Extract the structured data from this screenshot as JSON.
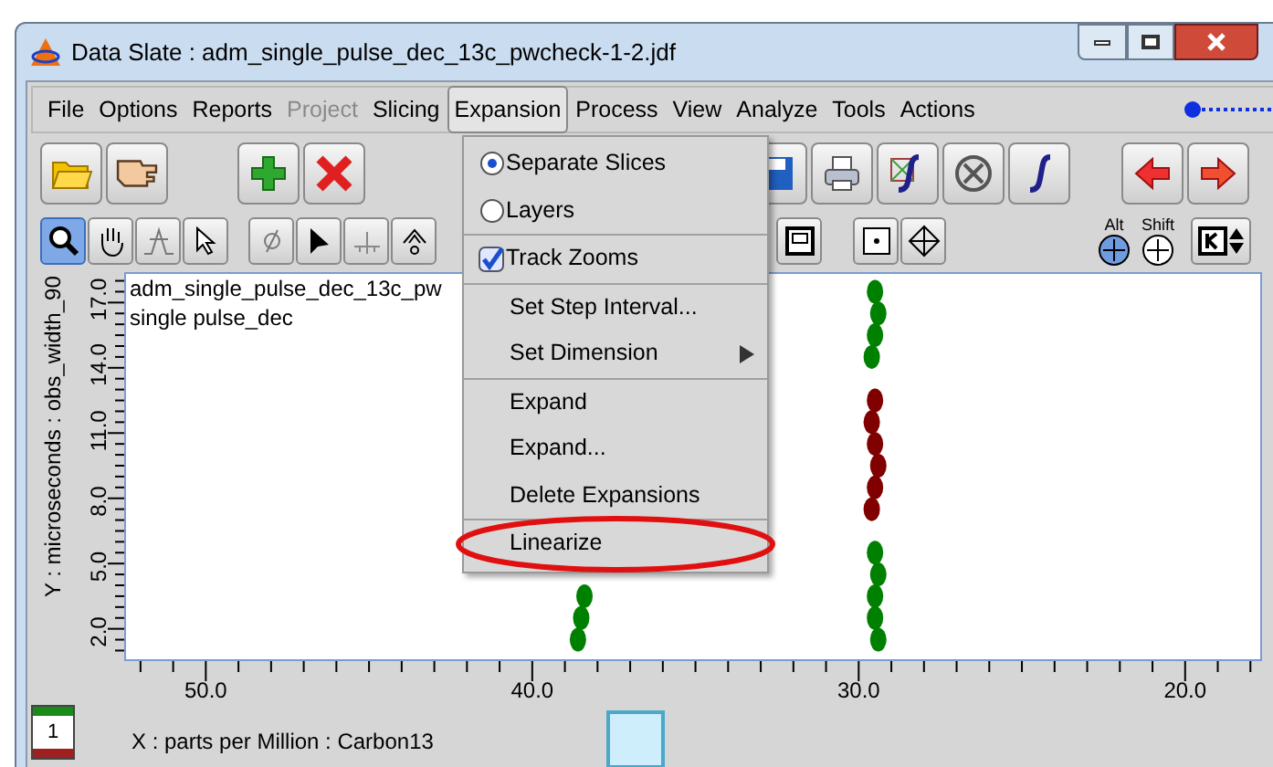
{
  "window": {
    "title": "Data Slate : adm_single_pulse_dec_13c_pwcheck-1-2.jdf"
  },
  "menu_bar": [
    {
      "label": "File",
      "disabled": false,
      "selected": false
    },
    {
      "label": "Options",
      "disabled": false,
      "selected": false
    },
    {
      "label": "Reports",
      "disabled": false,
      "selected": false
    },
    {
      "label": "Project",
      "disabled": true,
      "selected": false
    },
    {
      "label": "Slicing",
      "disabled": false,
      "selected": false
    },
    {
      "label": "Expansion",
      "disabled": false,
      "selected": true
    },
    {
      "label": "Process",
      "disabled": false,
      "selected": false
    },
    {
      "label": "View",
      "disabled": false,
      "selected": false
    },
    {
      "label": "Analyze",
      "disabled": false,
      "selected": false
    },
    {
      "label": "Tools",
      "disabled": false,
      "selected": false
    },
    {
      "label": "Actions",
      "disabled": false,
      "selected": false
    }
  ],
  "toolbar_1": [
    [
      {
        "kind": "folder"
      },
      {
        "kind": "hand"
      }
    ],
    [
      {
        "kind": "plus"
      },
      {
        "kind": "cross"
      }
    ],
    [
      {
        "kind": "save"
      },
      {
        "kind": "printer"
      },
      {
        "kind": "spline"
      },
      {
        "kind": "circle-x"
      },
      {
        "kind": "integral"
      }
    ],
    [
      {
        "kind": "arrow-left"
      },
      {
        "kind": "arrow-right"
      }
    ]
  ],
  "toolbar_2": [
    [
      {
        "kind": "zoom",
        "selected": true
      },
      {
        "kind": "pan",
        "selected": false
      },
      {
        "kind": "peak",
        "selected": false
      },
      {
        "kind": "pointer",
        "selected": false
      }
    ],
    [
      {
        "kind": "phi",
        "selected": false
      },
      {
        "kind": "arrow",
        "selected": false
      },
      {
        "kind": "baseline",
        "selected": false
      },
      {
        "kind": "hat",
        "selected": false
      }
    ],
    [
      {
        "kind": "frame",
        "selected": false
      }
    ],
    [
      {
        "kind": "dot",
        "selected": false
      },
      {
        "kind": "crosshair",
        "selected": false
      }
    ]
  ],
  "modifiers": [
    {
      "label": "Alt",
      "on": true
    },
    {
      "label": "Shift",
      "on": false
    }
  ],
  "expansion_menu": {
    "groups": [
      [
        {
          "kind": "radio",
          "label": "Separate Slices",
          "selected": true,
          "circled": false
        },
        {
          "kind": "radio",
          "label": "Layers",
          "selected": false,
          "circled": false
        }
      ],
      [
        {
          "kind": "check",
          "label": "Track Zooms",
          "checked": true,
          "circled": false
        }
      ],
      [
        {
          "kind": "command",
          "label": "Set Step Interval...",
          "circled": false
        },
        {
          "kind": "submenu",
          "label": "Set Dimension",
          "circled": false
        }
      ],
      [
        {
          "kind": "command",
          "label": "Expand",
          "circled": false
        },
        {
          "kind": "command",
          "label": "Expand...",
          "circled": false
        },
        {
          "kind": "command",
          "label": "Delete Expansions",
          "circled": false
        }
      ],
      [
        {
          "kind": "command",
          "label": "Linearize",
          "circled": true
        }
      ]
    ]
  },
  "plot": {
    "labels": [
      "adm_single_pulse_dec_13c_pw",
      "single pulse_dec"
    ],
    "chart_data": {
      "type": "scatter",
      "xlabel": "X : parts per Million : Carbon13",
      "ylabel": "Y : microseconds : obs_width_90",
      "xlim": [
        52.5,
        17.7
      ],
      "ylim": [
        0.6,
        18.4
      ],
      "xticks": [
        {
          "value": 50,
          "label": "50.0"
        },
        {
          "value": 40,
          "label": "40.0"
        },
        {
          "value": 30,
          "label": "30.0"
        },
        {
          "value": 20,
          "label": "20.0"
        }
      ],
      "yticks": [
        {
          "value": 2,
          "label": "2.0"
        },
        {
          "value": 5,
          "label": "5.0"
        },
        {
          "value": 8,
          "label": "8.0"
        },
        {
          "value": 11,
          "label": "11.0"
        },
        {
          "value": 14,
          "label": "14.0"
        },
        {
          "value": 17,
          "label": "17.0"
        }
      ],
      "series": [
        {
          "color": "#008000",
          "x": [
            38.6,
            38.5,
            38.4,
            29.4,
            29.5,
            29.5,
            29.4,
            29.5,
            29.6,
            29.5,
            29.4,
            29.5
          ],
          "values": [
            1.5,
            2.5,
            3.5,
            1.5,
            2.5,
            3.5,
            4.5,
            5.5,
            14.5,
            15.5,
            16.5,
            17.5
          ]
        },
        {
          "color": "#800000",
          "x": [
            29.6,
            29.5,
            29.4,
            29.5,
            29.6,
            29.5
          ],
          "values": [
            7.5,
            8.5,
            9.5,
            10.5,
            11.5,
            12.5
          ]
        }
      ]
    }
  },
  "legend_tile": {
    "label": "1"
  }
}
